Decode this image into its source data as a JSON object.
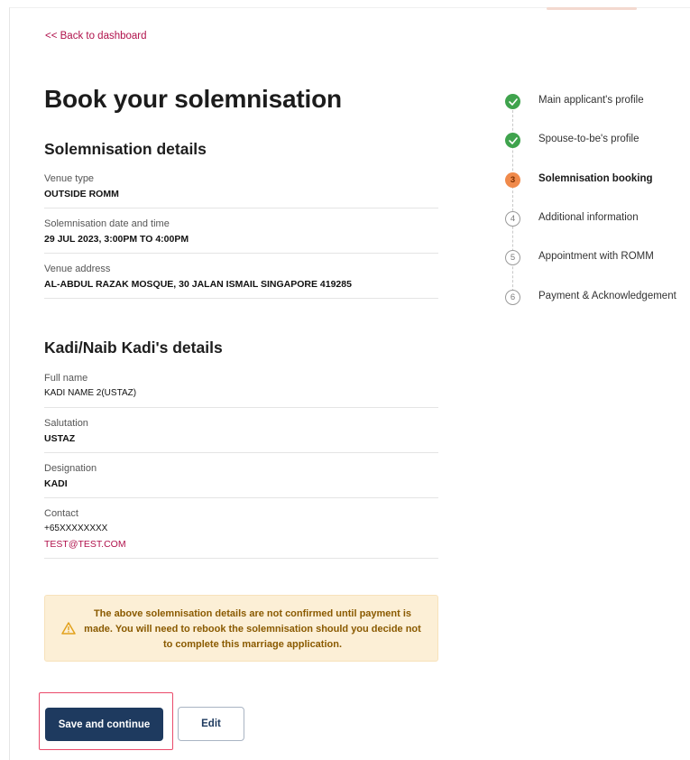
{
  "nav": {
    "back_label": "<< Back to dashboard"
  },
  "page": {
    "title": "Book your solemnisation"
  },
  "solemnisation": {
    "heading": "Solemnisation details",
    "venue_type_label": "Venue type",
    "venue_type_value": "OUTSIDE ROMM",
    "datetime_label": "Solemnisation date and time",
    "datetime_value": "29 JUL 2023, 3:00PM TO 4:00PM",
    "address_label": "Venue address",
    "address_value": "AL-ABDUL RAZAK MOSQUE, 30 JALAN ISMAIL SINGAPORE 419285"
  },
  "kadi": {
    "heading": "Kadi/Naib Kadi's details",
    "fullname_label": "Full name",
    "fullname_value": "KADI NAME 2(USTAZ)",
    "salutation_label": "Salutation",
    "salutation_value": "USTAZ",
    "designation_label": "Designation",
    "designation_value": "KADI",
    "contact_label": "Contact",
    "contact_phone": "+65XXXXXXXX",
    "contact_email": "TEST@TEST.COM"
  },
  "warning": {
    "icon": "warning-triangle-icon",
    "text": "The above solemnisation details are not confirmed until payment is made. You will need to rebook the solemnisation should you decide not to complete this marriage application."
  },
  "actions": {
    "save_label": "Save and continue",
    "edit_label": "Edit"
  },
  "stepper": {
    "steps": [
      {
        "label": "Main applicant's profile",
        "status": "done",
        "marker": ""
      },
      {
        "label": "Spouse-to-be's profile",
        "status": "done",
        "marker": ""
      },
      {
        "label": "Solemnisation booking",
        "status": "current",
        "marker": "3"
      },
      {
        "label": "Additional information",
        "status": "todo",
        "marker": "4"
      },
      {
        "label": "Appointment with ROMM",
        "status": "todo",
        "marker": "5"
      },
      {
        "label": "Payment & Acknowledgement",
        "status": "todo",
        "marker": "6"
      }
    ]
  },
  "colors": {
    "primary": "#1e3a5f",
    "link": "#b0114b",
    "done": "#3fa34d",
    "current": "#f08a4b",
    "warning_bg": "#fcefd6",
    "warning_text": "#8a5a00"
  }
}
